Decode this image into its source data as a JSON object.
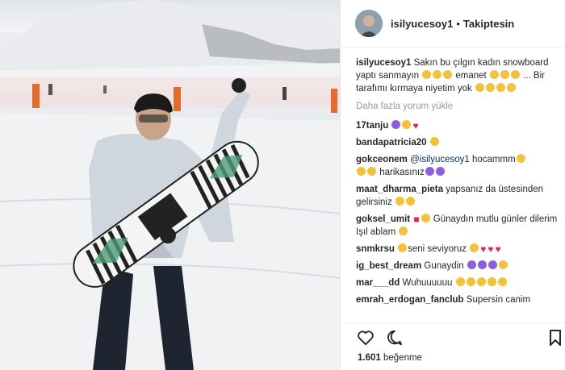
{
  "post": {
    "username": "isilyucesoy1",
    "follow_status": "Takiptesin",
    "caption_user": "isilyucesoy1",
    "caption_text_1": "Sakın bu çılgın kadın snowboard yaptı sanmayın",
    "caption_text_2": "emanet",
    "caption_text_3": "... Bir tarafımı kırmaya niyetim yok",
    "load_more": "Daha fazla yorum yükle",
    "likes_count": "1.601",
    "likes_label": "beğenme"
  },
  "comments": [
    {
      "user": "17tanju",
      "text": ""
    },
    {
      "user": "bandapatricia20",
      "text": ""
    },
    {
      "user": "gokceonem",
      "mention": "@isilyucesoy1",
      "text": "hocammm",
      "text2": "harikasınız"
    },
    {
      "user": "maat_dharma_pieta",
      "text": "yapsanız da üstesinden gelirsiniz"
    },
    {
      "user": "goksel_umit",
      "text": "Günaydın mutlu günler dilerim Işıl ablam"
    },
    {
      "user": "snmkrsu",
      "text": "seni seviyoruz"
    },
    {
      "user": "ig_best_dream",
      "text": "Gunaydin"
    },
    {
      "user": "mar___dd",
      "text": "Wuhuuuuuu"
    },
    {
      "user": "emrah_erdogan_fanclub",
      "text": "Supersin canim"
    }
  ],
  "icons": {
    "like": "heart-outline-icon",
    "comment": "comment-bubble-icon",
    "save": "bookmark-icon"
  }
}
